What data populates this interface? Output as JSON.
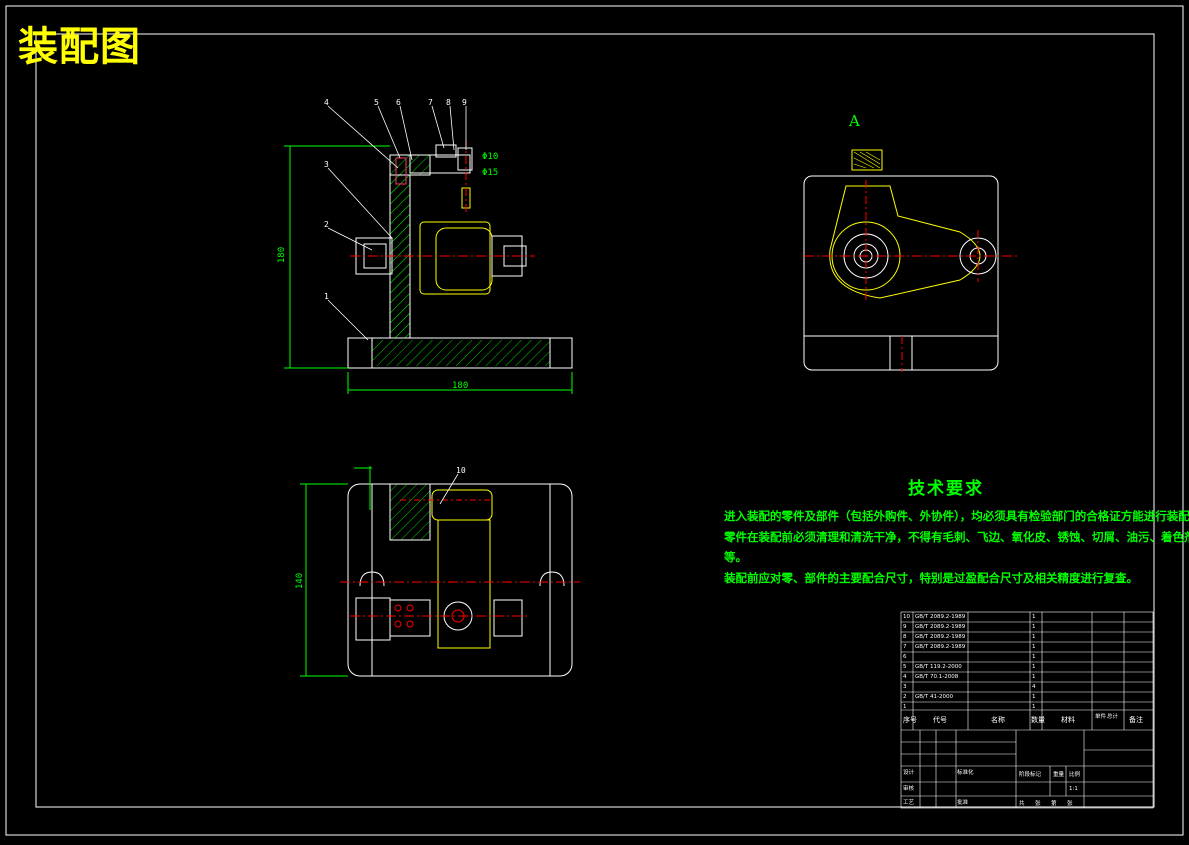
{
  "title": "装配图",
  "view_label": "A",
  "technical_requirements": {
    "heading": "技术要求",
    "lines": [
      "进入装配的零件及部件（包括外购件、外协件），均必须具有检验部门的合格证方能进行装配。",
      "零件在装配前必须清理和清洗干净，不得有毛刺、飞边、氧化皮、锈蚀、切屑、油污、着色剂和灰尘",
      "等。",
      "装配前应对零、部件的主要配合尺寸，特别是过盈配合尺寸及相关精度进行复查。"
    ]
  },
  "callouts": [
    "1",
    "2",
    "3",
    "4",
    "5",
    "6",
    "7",
    "8",
    "9",
    "10"
  ],
  "dimensions": {
    "front_height": "180",
    "front_width": "180",
    "top_height": "140",
    "dia_10": "Φ10",
    "dia_15": "Φ15"
  },
  "bom": {
    "header": [
      "序号",
      "代号",
      "名称",
      "数量",
      "材料",
      "单件",
      "总计",
      "备注"
    ],
    "rows": [
      [
        "10",
        "GB/T 2089.2-1989",
        "",
        "1",
        "",
        "",
        "",
        ""
      ],
      [
        "9",
        "GB/T 2089.2-1989",
        "",
        "1",
        "",
        "",
        "",
        ""
      ],
      [
        "8",
        "GB/T 2089.2-1989",
        "",
        "1",
        "",
        "",
        "",
        ""
      ],
      [
        "7",
        "GB/T 2089.2-1989",
        "",
        "1",
        "",
        "",
        "",
        ""
      ],
      [
        "6",
        "",
        "",
        "1",
        "",
        "",
        "",
        ""
      ],
      [
        "5",
        "GB/T 119.2-2000",
        "",
        "1",
        "",
        "",
        "",
        ""
      ],
      [
        "4",
        "GB/T 70.1-2008",
        "",
        "1",
        "",
        "",
        "",
        ""
      ],
      [
        "3",
        "",
        "",
        "4",
        "",
        "",
        "",
        ""
      ],
      [
        "2",
        "GB/T 41-2000",
        "",
        "1",
        "",
        "",
        "",
        ""
      ],
      [
        "1",
        "",
        "",
        "1",
        "",
        "",
        "",
        ""
      ]
    ]
  },
  "title_block": {
    "scale": "1:1",
    "labels": [
      "设计",
      "标准化",
      "审核",
      "工艺",
      "批准",
      "阶段标记",
      "重量",
      "比例",
      "共",
      "张",
      "第",
      "张"
    ]
  },
  "colors": {
    "background": "#000000",
    "frame": "#ffffff",
    "dimension": "#00ff00",
    "part": "#ffff00",
    "hatch": "#00cc00",
    "centerline": "#ff0000",
    "title": "#ffff00"
  }
}
